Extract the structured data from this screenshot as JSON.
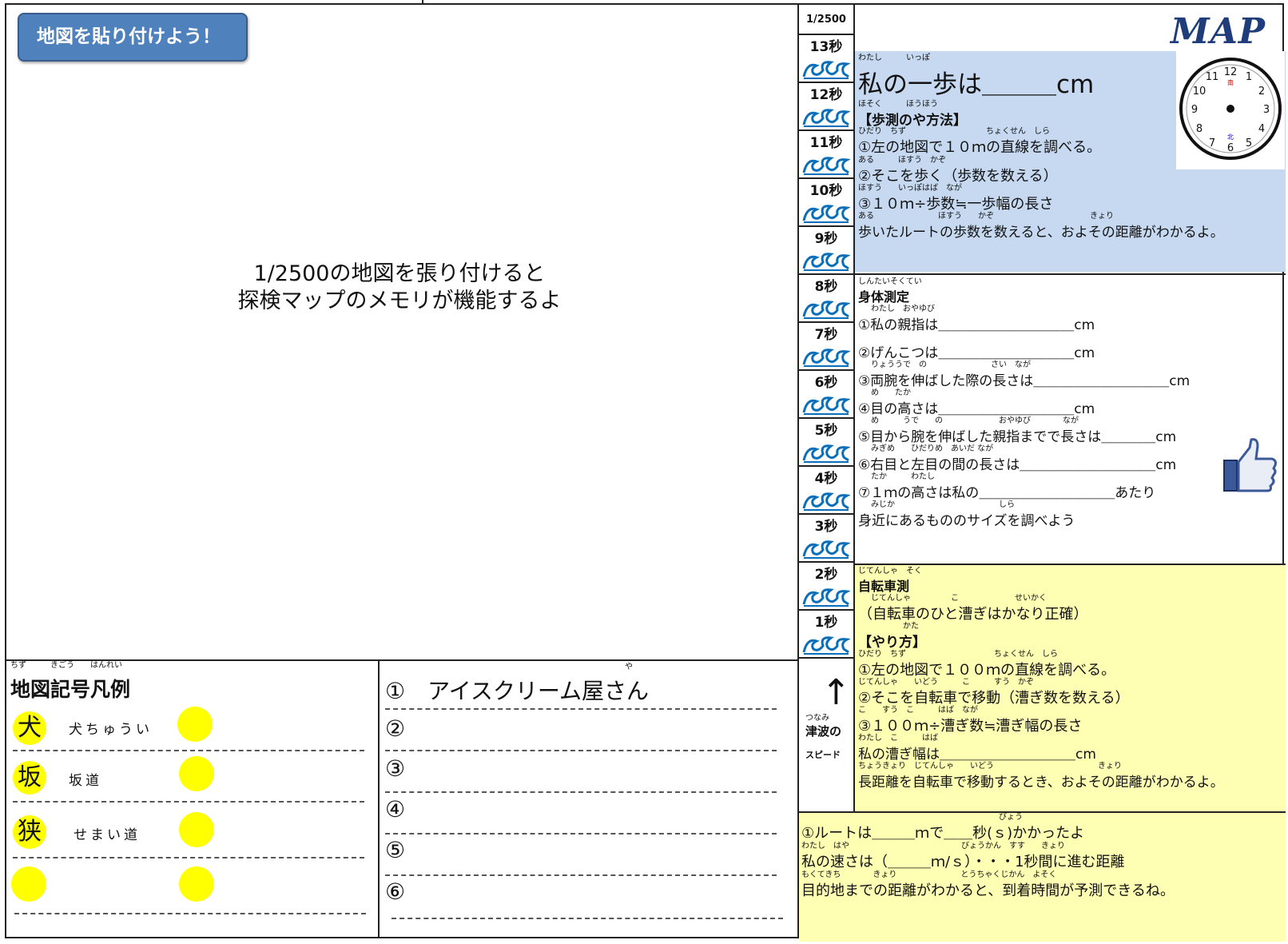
{
  "header": {
    "paste_button": "地図を貼り付けよう！",
    "logo": "MAP"
  },
  "center_note": {
    "line1": "1/2500の地図を張り付けると",
    "line2": "探検マップのメモリが機能するよ"
  },
  "scale": {
    "label": "1/2500",
    "seconds": [
      "13秒",
      "12秒",
      "11秒",
      "10秒",
      "9秒",
      "8秒",
      "7秒",
      "6秒",
      "5秒",
      "4秒",
      "3秒",
      "2秒",
      "1秒"
    ]
  },
  "speed_label": {
    "ruby": "つなみ",
    "line1": "津波の",
    "line2": "スピード",
    "arrow": "↑"
  },
  "step": {
    "ruby1": "わたし　　　いっぽ",
    "title": "私の一歩は＿＿＿cm",
    "ruby2": "ほそく　　　ほうほう",
    "method_title": "【歩測のや方法】",
    "r3": "ひだり　ちず　　　　　　　　　　ちょくせん　しら",
    "s1": "①左の地図で１０ｍの直線を調べる。",
    "r4": "ある　　　ほすう　かぞ",
    "s2": "②そこを歩く（歩数を数える）",
    "r5": "ほすう　　いっぽはば　なが",
    "s3": "③１０ｍ÷歩数≒一歩幅の長さ",
    "r6": "ある　　　　　　　　ほすう　　かぞ　　　　　　　　　　　　きょり",
    "s4": "歩いたルートの歩数を数えると、およその距離がわかるよ。"
  },
  "body": {
    "r0": "しんたいそくてい",
    "title": "身体測定",
    "items": [
      {
        "ruby": "わたし　おやゆび",
        "text": "①私の親指は＿＿＿＿＿＿＿＿＿＿cm"
      },
      {
        "ruby": "",
        "text": "②げんこつは＿＿＿＿＿＿＿＿＿＿cm"
      },
      {
        "ruby": "りょううで　の　　　　　　　　さい　なが",
        "text": "③両腕を伸ばした際の長さは＿＿＿＿＿＿＿＿＿＿cm"
      },
      {
        "ruby": "め　　たか",
        "text": "④目の高さは＿＿＿＿＿＿＿＿＿＿cm"
      },
      {
        "ruby": "め　　　うで　　の　　　　　　　おやゆび　　　　なが",
        "text": "⑤目から腕を伸ばした親指までで長さは＿＿＿＿cm"
      },
      {
        "ruby": "みぎめ　　ひだりめ　あいだ なが",
        "text": "⑥右目と左目の間の長さは＿＿＿＿＿＿＿＿＿＿cm"
      },
      {
        "ruby": "たか　　　わたし",
        "text": "⑦１ｍの高さは私の＿＿＿＿＿＿＿＿＿＿あたり"
      },
      {
        "ruby": "みじか　　　　　　　　　　　　　しら",
        "text": "身近にあるもののサイズを調べよう"
      }
    ]
  },
  "bike": {
    "r0": "じてんしゃ　そく",
    "title": "自転車測",
    "r1": "じてんしゃ　　　　　こ　　　　　　　せいかく",
    "l1": "（自転車のひと漕ぎはかなり正確）",
    "r2": "かた",
    "l2": "【やり方】",
    "r3": "ひだり　ちず　　　　　　　　　　　ちょくせん　しら",
    "l3": "①左の地図で１００ｍの直線を調べる。",
    "r4": "じてんしゃ　　いどう　　　こ　　　すう　かぞ",
    "l4": "②そこを自転車で移動（漕ぎ数を数える）",
    "r5": "こ　　すう　こ　　　はば　なが",
    "l5": "③１００ｍ÷漕ぎ数≒漕ぎ幅の長さ",
    "r6": "わたし　こ　　　はば",
    "l6": "私の漕ぎ幅は＿＿＿＿＿＿＿＿＿＿cm",
    "r7": "ちょうきょり　じてんしゃ　　いどう　　　　　　　　　　　　　きょり",
    "l7": "長距離を自転車で移動するとき、およその距離がわかるよ。"
  },
  "speed": {
    "r0": "びょう",
    "l1": "①ルートは＿＿＿ｍで＿＿秒(ｓ)かかったよ",
    "r1": "わたし　はや　　　　　　　　　　　　　　びょうかん　すす　　きょり",
    "l2": "私の速さは（＿＿＿ｍ/ｓ）・・・1秒間に進む距離",
    "r2": "もくてきち　　　　きょり　　　　　　　　とうちゃくじかん　よそく",
    "l3": "目的地までの距離がわかると、到着時間が予測できるね。"
  },
  "legend": {
    "ruby": "ちず　　　きごう　　はんれい",
    "title": "地図記号凡例",
    "rows": [
      {
        "kanji": "犬",
        "label": "犬ちゅうい"
      },
      {
        "kanji": "坂",
        "label": "坂道"
      },
      {
        "kanji": "狭",
        "label": "せまい道"
      }
    ]
  },
  "shops": {
    "ruby": "や",
    "rows": [
      "①　アイスクリーム屋さん",
      "②",
      "③",
      "④",
      "⑤",
      "⑥"
    ]
  }
}
